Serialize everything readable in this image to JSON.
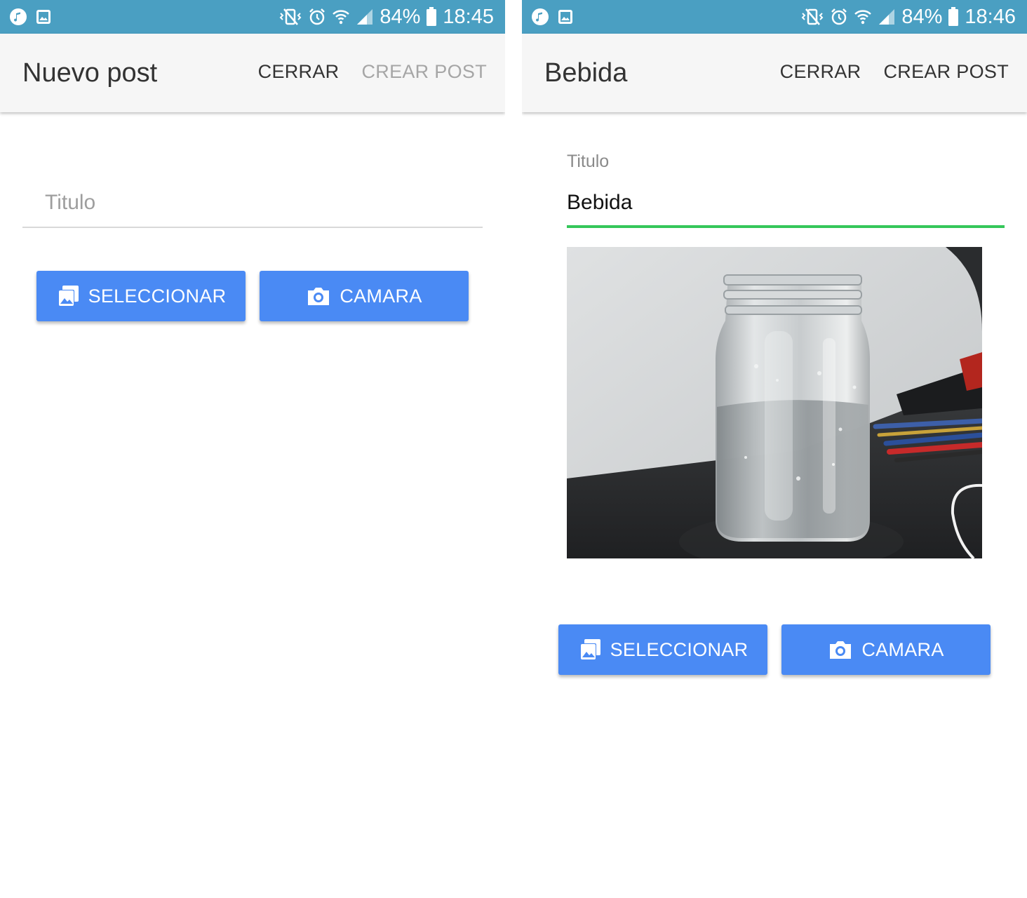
{
  "screens": [
    {
      "status": {
        "battery": "84%",
        "time": "18:45"
      },
      "toolbar": {
        "title": "Nuevo post",
        "close_label": "CERRAR",
        "create_label": "CREAR POST",
        "create_enabled": false
      },
      "form": {
        "title_label": "Titulo",
        "title_value": "",
        "title_placeholder": "Titulo",
        "focused": false,
        "has_photo": false
      },
      "buttons": {
        "select_label": "SELECCIONAR",
        "camera_label": "CAMARA"
      }
    },
    {
      "status": {
        "battery": "84%",
        "time": "18:46"
      },
      "toolbar": {
        "title": "Bebida",
        "close_label": "CERRAR",
        "create_label": "CREAR POST",
        "create_enabled": true
      },
      "form": {
        "title_label": "Titulo",
        "title_value": "Bebida",
        "title_placeholder": "",
        "focused": true,
        "has_photo": true
      },
      "buttons": {
        "select_label": "SELECCIONAR",
        "camera_label": "CAMARA"
      }
    }
  ],
  "icons": {
    "status_left": [
      "music-note-icon",
      "image-notification-icon"
    ],
    "status_right": [
      "vibrate-mute-icon",
      "alarm-icon",
      "wifi-icon",
      "signal-icon",
      "battery-icon"
    ],
    "select_button": "gallery-icon",
    "camera_button": "camera-icon"
  },
  "colors": {
    "status_bar": "#4a9fc2",
    "toolbar": "#f6f6f6",
    "button": "#4a8af4",
    "focused_underline": "#35c75a",
    "disabled_text": "#a6a6a6"
  }
}
